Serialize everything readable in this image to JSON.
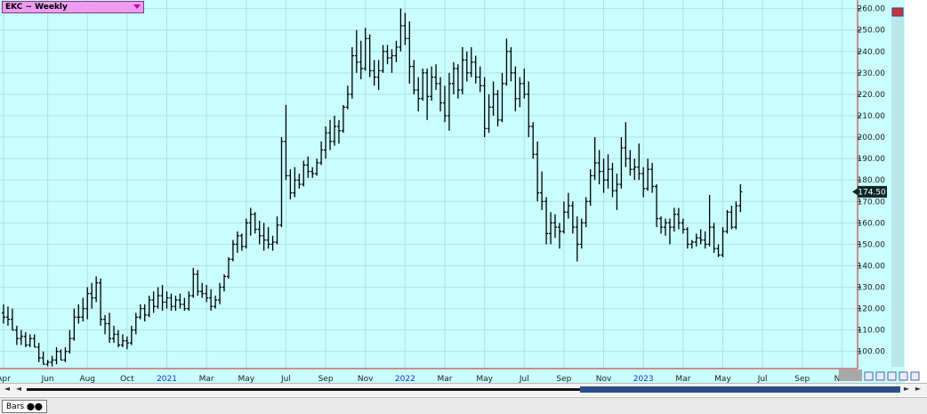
{
  "window": {
    "title": "EKC ~ Weekly"
  },
  "status": {
    "tab_label": "Bars"
  },
  "colors": {
    "plot_bg": "#c9fdfe",
    "grid": "#aee3e6",
    "axis_line": "#cc2222",
    "bar": "#000000",
    "price_tag_bg": "#0e2828",
    "price_tag_text": "#ffffff",
    "year_label": "#1a33cc"
  },
  "chart_data": {
    "type": "ohlc",
    "title": "EKC ~ Weekly",
    "y_axis": {
      "side": "right",
      "ylim": [
        92,
        264
      ],
      "ticks": [
        "260.00",
        "250.00",
        "240.00",
        "230.00",
        "220.00",
        "210.00",
        "200.00",
        "190.00",
        "180.00",
        "170.00",
        "160.00",
        "150.00",
        "140.00",
        "130.00",
        "120.00",
        "110.00",
        "100.00"
      ],
      "tick_values": [
        260,
        250,
        240,
        230,
        220,
        210,
        200,
        190,
        180,
        170,
        160,
        150,
        140,
        130,
        120,
        110,
        100
      ]
    },
    "x_axis": {
      "labels": [
        {
          "text": "Apr",
          "bar": 0,
          "year": false
        },
        {
          "text": "Jun",
          "bar": 10,
          "year": false
        },
        {
          "text": "Aug",
          "bar": 19,
          "year": false
        },
        {
          "text": "Oct",
          "bar": 28,
          "year": false
        },
        {
          "text": "2021",
          "bar": 37,
          "year": true
        },
        {
          "text": "Mar",
          "bar": 46,
          "year": false
        },
        {
          "text": "May",
          "bar": 55,
          "year": false
        },
        {
          "text": "Jul",
          "bar": 64,
          "year": false
        },
        {
          "text": "Sep",
          "bar": 73,
          "year": false
        },
        {
          "text": "Nov",
          "bar": 82,
          "year": false
        },
        {
          "text": "2022",
          "bar": 91,
          "year": true
        },
        {
          "text": "Mar",
          "bar": 100,
          "year": false
        },
        {
          "text": "May",
          "bar": 109,
          "year": false
        },
        {
          "text": "Jul",
          "bar": 118,
          "year": false
        },
        {
          "text": "Sep",
          "bar": 127,
          "year": false
        },
        {
          "text": "Nov",
          "bar": 136,
          "year": false
        },
        {
          "text": "2023",
          "bar": 145,
          "year": true
        },
        {
          "text": "Mar",
          "bar": 154,
          "year": false
        },
        {
          "text": "May",
          "bar": 163,
          "year": false
        },
        {
          "text": "Jul",
          "bar": 172,
          "year": false
        },
        {
          "text": "Sep",
          "bar": 181,
          "year": false
        },
        {
          "text": "Nov",
          "bar": 190,
          "year": false
        }
      ]
    },
    "last_price": "174.50",
    "last_value": 174.5,
    "grid": true,
    "bars": [
      [
        118.0,
        122.0,
        113.0,
        116.0
      ],
      [
        116.0,
        121.0,
        112.0,
        115.0
      ],
      [
        115.0,
        120.0,
        110.0,
        110.0
      ],
      [
        110.0,
        112.0,
        103.0,
        106.0
      ],
      [
        106.0,
        110.0,
        103.0,
        107.0
      ],
      [
        107.0,
        109.0,
        102.0,
        103.0
      ],
      [
        103.0,
        108.0,
        102.0,
        106.0
      ],
      [
        106.0,
        108.0,
        102.0,
        102.0
      ],
      [
        102.0,
        104.0,
        95.0,
        97.0
      ],
      [
        97.0,
        100.0,
        94.0,
        94.0
      ],
      [
        94.0,
        96.0,
        93.0,
        95.0
      ],
      [
        95.0,
        98.0,
        93.0,
        96.0
      ],
      [
        96.0,
        102.0,
        94.0,
        100.0
      ],
      [
        100.0,
        101.0,
        96.0,
        96.0
      ],
      [
        96.0,
        102.0,
        95.0,
        100.0
      ],
      [
        100.0,
        110.0,
        99.0,
        106.0
      ],
      [
        106.0,
        120.0,
        105.0,
        116.0
      ],
      [
        116.0,
        122.0,
        113.0,
        116.0
      ],
      [
        116.0,
        125.0,
        114.0,
        120.0
      ],
      [
        120.0,
        130.0,
        115.0,
        127.0
      ],
      [
        127.0,
        132.0,
        120.0,
        125.0
      ],
      [
        125.0,
        135.0,
        123.0,
        132.0
      ],
      [
        132.0,
        134.0,
        112.0,
        115.0
      ],
      [
        115.0,
        117.0,
        108.0,
        113.0
      ],
      [
        113.0,
        118.0,
        104.0,
        106.0
      ],
      [
        106.0,
        112.0,
        104.0,
        108.0
      ],
      [
        108.0,
        110.0,
        102.0,
        103.0
      ],
      [
        103.0,
        108.0,
        102.0,
        105.0
      ],
      [
        105.0,
        107.0,
        101.0,
        104.0
      ],
      [
        104.0,
        112.0,
        103.0,
        110.0
      ],
      [
        110.0,
        118.0,
        108.0,
        116.0
      ],
      [
        116.0,
        122.0,
        115.0,
        120.0
      ],
      [
        120.0,
        122.0,
        114.0,
        117.0
      ],
      [
        117.0,
        126.0,
        116.0,
        124.0
      ],
      [
        124.0,
        128.0,
        118.0,
        121.0
      ],
      [
        121.0,
        130.0,
        120.0,
        126.0
      ],
      [
        126.0,
        131.0,
        119.0,
        123.0
      ],
      [
        123.0,
        128.0,
        120.0,
        125.0
      ],
      [
        125.0,
        127.0,
        119.0,
        121.0
      ],
      [
        121.0,
        126.0,
        119.0,
        124.0
      ],
      [
        124.0,
        127.0,
        120.0,
        122.0
      ],
      [
        122.0,
        125.0,
        119.0,
        120.0
      ],
      [
        120.0,
        128.0,
        119.0,
        126.0
      ],
      [
        126.0,
        139.0,
        125.0,
        136.0
      ],
      [
        136.0,
        138.0,
        126.0,
        128.0
      ],
      [
        128.0,
        132.0,
        125.0,
        127.0
      ],
      [
        127.0,
        131.0,
        123.0,
        125.0
      ],
      [
        125.0,
        129.0,
        119.0,
        121.0
      ],
      [
        121.0,
        126.0,
        120.0,
        124.0
      ],
      [
        124.0,
        132.0,
        122.0,
        130.0
      ],
      [
        130.0,
        136.0,
        128.0,
        135.0
      ],
      [
        135.0,
        144.0,
        134.0,
        143.0
      ],
      [
        143.0,
        152.0,
        142.0,
        150.0
      ],
      [
        150.0,
        156.0,
        146.0,
        154.0
      ],
      [
        154.0,
        155.0,
        147.0,
        149.0
      ],
      [
        149.0,
        162.0,
        148.0,
        160.0
      ],
      [
        160.0,
        167.0,
        154.0,
        164.0
      ],
      [
        164.0,
        165.0,
        155.0,
        157.0
      ],
      [
        157.0,
        161.0,
        150.0,
        154.0
      ],
      [
        154.0,
        160.0,
        147.0,
        152.0
      ],
      [
        152.0,
        158.0,
        148.0,
        150.0
      ],
      [
        150.0,
        154.0,
        147.0,
        151.0
      ],
      [
        151.0,
        163.0,
        150.0,
        159.0
      ],
      [
        159.0,
        200.0,
        158.0,
        198.0
      ],
      [
        198.0,
        215.0,
        180.0,
        182.0
      ],
      [
        182.0,
        185.0,
        171.0,
        174.0
      ],
      [
        174.0,
        186.0,
        172.0,
        180.0
      ],
      [
        180.0,
        183.0,
        176.0,
        178.0
      ],
      [
        178.0,
        189.0,
        177.0,
        187.0
      ],
      [
        187.0,
        191.0,
        181.0,
        184.0
      ],
      [
        184.0,
        186.0,
        181.0,
        183.0
      ],
      [
        183.0,
        190.0,
        182.0,
        188.0
      ],
      [
        188.0,
        198.0,
        187.0,
        194.0
      ],
      [
        194.0,
        205.0,
        190.0,
        202.0
      ],
      [
        202.0,
        208.0,
        194.0,
        198.0
      ],
      [
        198.0,
        210.0,
        196.0,
        205.0
      ],
      [
        205.0,
        208.0,
        197.0,
        203.0
      ],
      [
        203.0,
        215.0,
        202.0,
        214.0
      ],
      [
        214.0,
        224.0,
        213.0,
        220.0
      ],
      [
        220.0,
        242.0,
        218.0,
        238.0
      ],
      [
        238.0,
        250.0,
        230.0,
        235.0
      ],
      [
        235.0,
        245.0,
        227.0,
        232.0
      ],
      [
        232.0,
        251.0,
        231.0,
        246.0
      ],
      [
        246.0,
        248.0,
        228.0,
        231.0
      ],
      [
        231.0,
        236.0,
        224.0,
        228.0
      ],
      [
        228.0,
        236.0,
        222.0,
        231.0
      ],
      [
        231.0,
        243.0,
        230.0,
        240.0
      ],
      [
        240.0,
        243.0,
        234.0,
        237.0
      ],
      [
        237.0,
        241.0,
        230.0,
        238.0
      ],
      [
        238.0,
        245.0,
        235.0,
        242.0
      ],
      [
        242.0,
        260.0,
        240.0,
        252.0
      ],
      [
        252.0,
        258.0,
        243.0,
        246.0
      ],
      [
        246.0,
        254.0,
        225.0,
        233.0
      ],
      [
        233.0,
        236.0,
        220.0,
        222.0
      ],
      [
        222.0,
        228.0,
        212.0,
        218.0
      ],
      [
        218.0,
        232.0,
        217.0,
        230.0
      ],
      [
        230.0,
        232.0,
        208.0,
        219.0
      ],
      [
        219.0,
        233.0,
        217.0,
        228.0
      ],
      [
        228.0,
        234.0,
        222.0,
        225.0
      ],
      [
        225.0,
        228.0,
        212.0,
        216.0
      ],
      [
        216.0,
        224.0,
        207.0,
        210.0
      ],
      [
        210.0,
        230.0,
        203.0,
        225.0
      ],
      [
        225.0,
        235.0,
        220.0,
        232.0
      ],
      [
        232.0,
        234.0,
        218.0,
        222.0
      ],
      [
        222.0,
        242.0,
        220.0,
        236.0
      ],
      [
        236.0,
        240.0,
        226.0,
        230.0
      ],
      [
        230.0,
        242.0,
        228.0,
        235.0
      ],
      [
        235.0,
        238.0,
        225.0,
        228.0
      ],
      [
        228.0,
        233.0,
        221.0,
        224.0
      ],
      [
        224.0,
        228.0,
        200.0,
        204.0
      ],
      [
        204.0,
        220.0,
        202.0,
        214.0
      ],
      [
        214.0,
        226.0,
        210.0,
        220.0
      ],
      [
        220.0,
        222.0,
        205.0,
        208.0
      ],
      [
        208.0,
        230.0,
        207.0,
        225.0
      ],
      [
        225.0,
        246.0,
        224.0,
        240.0
      ],
      [
        240.0,
        242.0,
        226.0,
        230.0
      ],
      [
        230.0,
        233.0,
        212.0,
        218.0
      ],
      [
        218.0,
        228.0,
        214.0,
        225.0
      ],
      [
        225.0,
        232.0,
        218.0,
        220.0
      ],
      [
        220.0,
        226.0,
        200.0,
        205.0
      ],
      [
        205.0,
        207.0,
        190.0,
        192.0
      ],
      [
        192.0,
        198.0,
        170.0,
        174.0
      ],
      [
        174.0,
        184.0,
        166.0,
        170.0
      ],
      [
        170.0,
        172.0,
        150.0,
        155.0
      ],
      [
        155.0,
        165.0,
        150.0,
        160.0
      ],
      [
        160.0,
        164.0,
        153.0,
        158.0
      ],
      [
        158.0,
        160.0,
        148.0,
        156.0
      ],
      [
        156.0,
        170.0,
        155.0,
        165.0
      ],
      [
        165.0,
        174.0,
        162.0,
        168.0
      ],
      [
        168.0,
        170.0,
        155.0,
        158.0
      ],
      [
        158.0,
        163.0,
        142.0,
        150.0
      ],
      [
        150.0,
        162.0,
        148.0,
        160.0
      ],
      [
        160.0,
        172.0,
        158.0,
        170.0
      ],
      [
        170.0,
        185.0,
        168.0,
        182.0
      ],
      [
        182.0,
        200.0,
        180.0,
        188.0
      ],
      [
        188.0,
        194.0,
        178.0,
        184.0
      ],
      [
        184.0,
        190.0,
        174.0,
        180.0
      ],
      [
        180.0,
        192.0,
        176.0,
        185.0
      ],
      [
        185.0,
        188.0,
        172.0,
        175.0
      ],
      [
        175.0,
        183.0,
        166.0,
        178.0
      ],
      [
        178.0,
        200.0,
        176.0,
        195.0
      ],
      [
        195.0,
        207.0,
        186.0,
        190.0
      ],
      [
        190.0,
        194.0,
        182.0,
        185.0
      ],
      [
        185.0,
        190.0,
        180.0,
        186.0
      ],
      [
        186.0,
        197.0,
        180.0,
        183.0
      ],
      [
        183.0,
        186.0,
        172.0,
        176.0
      ],
      [
        176.0,
        190.0,
        175.0,
        185.0
      ],
      [
        185.0,
        188.0,
        174.0,
        177.0
      ],
      [
        177.0,
        178.0,
        158.0,
        162.0
      ],
      [
        162.0,
        163.0,
        155.0,
        158.0
      ],
      [
        158.0,
        162.0,
        154.0,
        160.0
      ],
      [
        160.0,
        162.0,
        150.0,
        158.0
      ],
      [
        158.0,
        167.0,
        156.0,
        164.0
      ],
      [
        164.0,
        167.0,
        157.0,
        160.0
      ],
      [
        160.0,
        162.0,
        155.0,
        157.0
      ],
      [
        157.0,
        158.0,
        148.0,
        150.0
      ],
      [
        150.0,
        152.0,
        148.0,
        151.0
      ],
      [
        151.0,
        155.0,
        149.0,
        153.0
      ],
      [
        153.0,
        157.0,
        150.0,
        152.0
      ],
      [
        152.0,
        156.0,
        148.0,
        150.0
      ],
      [
        150.0,
        173.0,
        149.0,
        158.0
      ],
      [
        158.0,
        160.0,
        146.0,
        148.0
      ],
      [
        148.0,
        150.0,
        144.0,
        145.0
      ],
      [
        145.0,
        158.0,
        144.0,
        156.0
      ],
      [
        156.0,
        166.0,
        155.0,
        165.0
      ],
      [
        165.0,
        168.0,
        157.0,
        158.0
      ],
      [
        158.0,
        170.0,
        157.0,
        168.0
      ],
      [
        168.0,
        178.0,
        165.0,
        174.5
      ]
    ]
  }
}
